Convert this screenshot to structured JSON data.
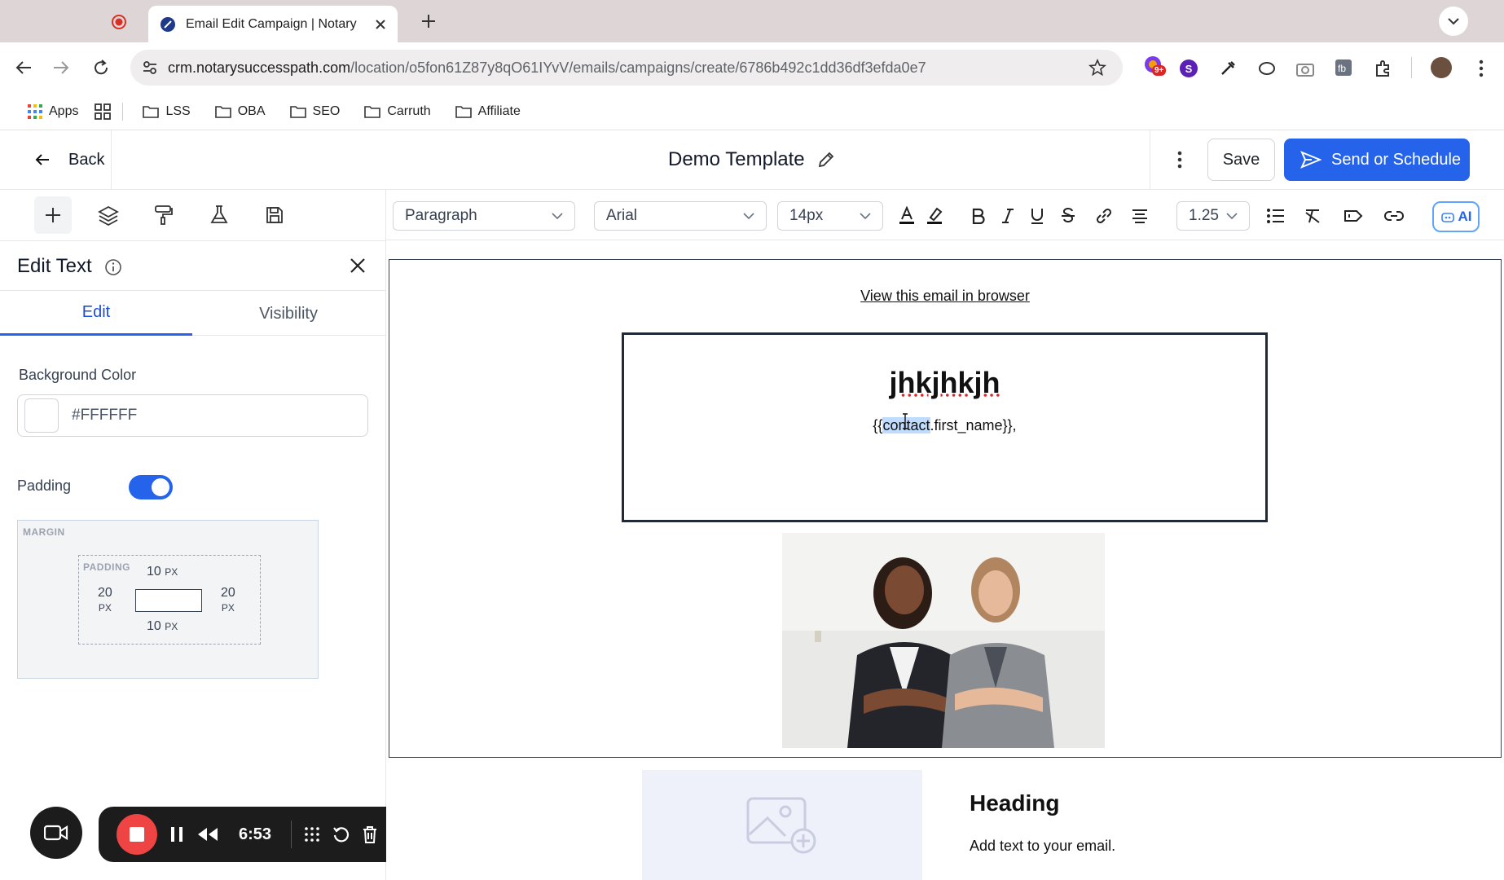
{
  "browser": {
    "tab_title": "Email Edit Campaign | Notary",
    "url_host": "crm.notarysuccesspath.com",
    "url_path": "/location/o5fon61Z87y8qO61IYvV/emails/campaigns/create/6786b492c1dd36df3efda0e7",
    "extension_badge": "9+",
    "profile_initial": "S",
    "bookmarks": [
      "Apps",
      "LSS",
      "OBA",
      "SEO",
      "Carruth",
      "Affiliate"
    ]
  },
  "header": {
    "back_label": "Back",
    "template_title": "Demo Template",
    "save_label": "Save",
    "send_label": "Send or Schedule"
  },
  "panel": {
    "title": "Edit Text",
    "tabs": [
      "Edit",
      "Visibility"
    ],
    "background_color_label": "Background Color",
    "background_color_value": "#FFFFFF",
    "padding_label": "Padding",
    "padding_enabled": true,
    "box_model": {
      "margin_caption": "MARGIN",
      "padding_caption": "PADDING",
      "top": "10",
      "bottom": "10",
      "left": "20",
      "right": "20",
      "unit": "PX"
    }
  },
  "format": {
    "block_type": "Paragraph",
    "font_family": "Arial",
    "font_size": "14px",
    "line_height": "1.25",
    "ai_label": "AI"
  },
  "canvas": {
    "view_in_browser": "View this email in browser",
    "hero_title": "jhkjhkjh",
    "hero_sub_before": "{{",
    "hero_sub_highlight": "contact",
    "hero_sub_after": ".first_name}},",
    "heading": "Heading",
    "body_text": "Add text to your email."
  },
  "recorder": {
    "time": "6:53"
  },
  "colors": {
    "accent": "#2563eb",
    "record": "#ef4444"
  }
}
